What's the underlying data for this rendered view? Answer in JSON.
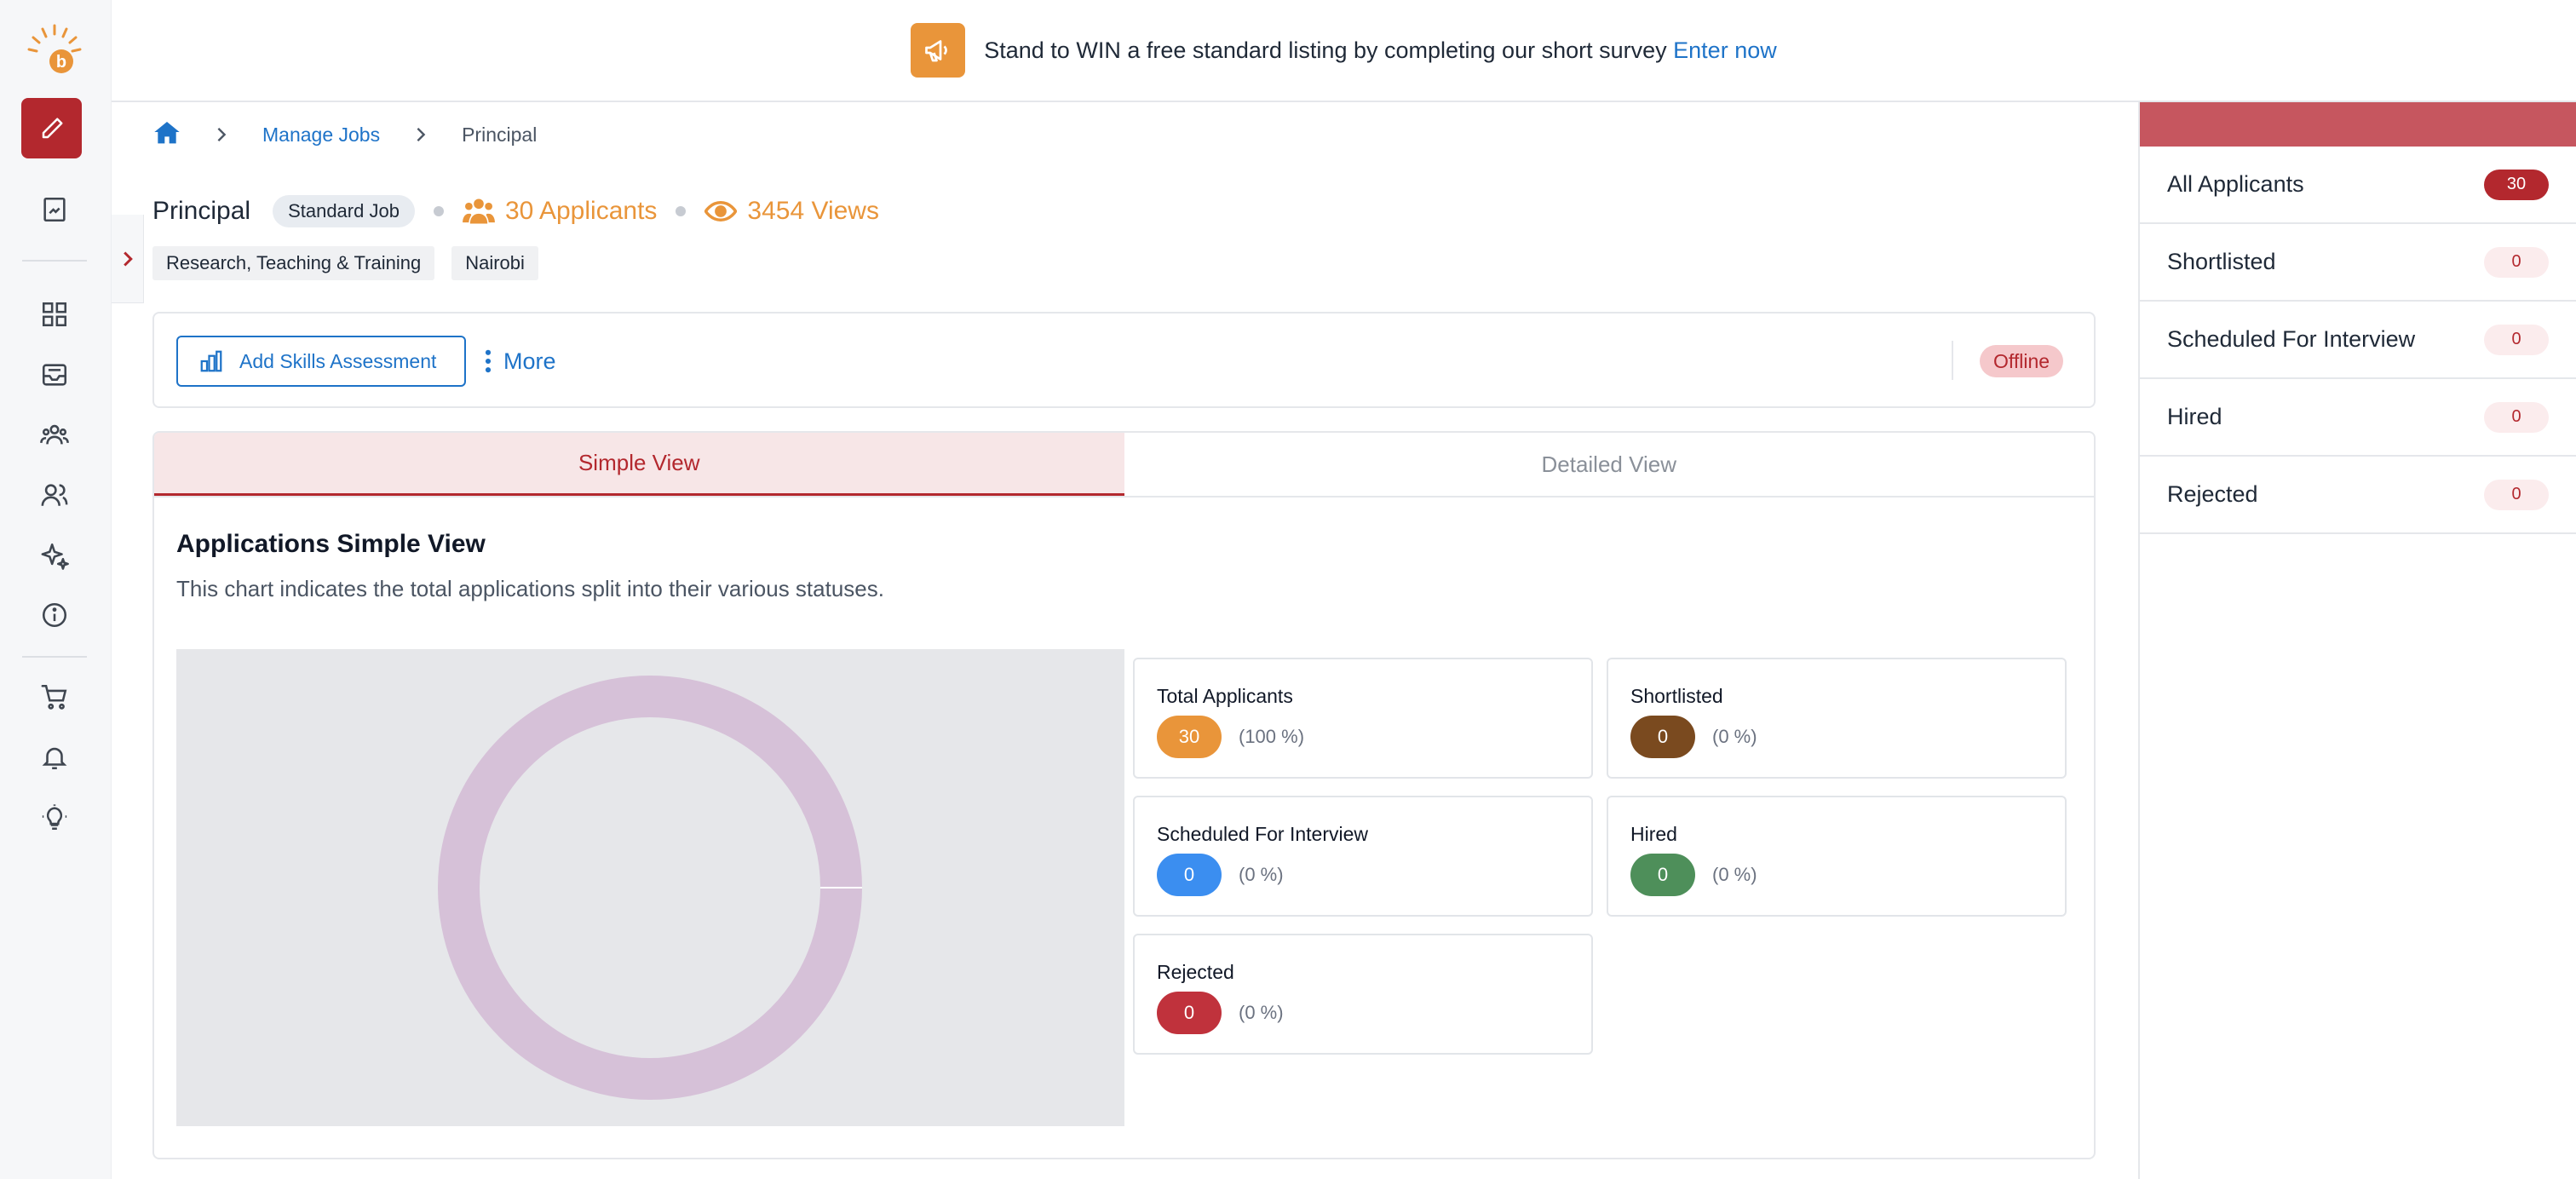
{
  "banner": {
    "message": "Stand to WIN a free standard listing by completing our short survey",
    "cta": "Enter now"
  },
  "breadcrumb": {
    "items": [
      "Manage Jobs",
      "Principal"
    ]
  },
  "job": {
    "title": "Principal",
    "type": "Standard Job",
    "applicants": "30 Applicants",
    "views": "3454 Views",
    "tags": [
      "Research, Teaching & Training",
      "Nairobi"
    ]
  },
  "toolbar": {
    "assess_label": "Add Skills Assessment",
    "more_label": "More",
    "status": "Offline"
  },
  "tabs": [
    {
      "label": "Simple View",
      "active": true
    },
    {
      "label": "Detailed View",
      "active": false
    }
  ],
  "section": {
    "title": "Applications Simple View",
    "description": "This chart indicates the total applications split into their various statuses."
  },
  "stats": [
    {
      "label": "Total Applicants",
      "value": "30",
      "percent": "(100 %)",
      "color": "#e9953a"
    },
    {
      "label": "Shortlisted",
      "value": "0",
      "percent": "(0 %)",
      "color": "#7a4a1f"
    },
    {
      "label": "Scheduled For Interview",
      "value": "0",
      "percent": "(0 %)",
      "color": "#3b8ef0"
    },
    {
      "label": "Hired",
      "value": "0",
      "percent": "(0 %)",
      "color": "#4e8f5a"
    },
    {
      "label": "Rejected",
      "value": "0",
      "percent": "(0 %)",
      "color": "#c0323c"
    }
  ],
  "chart_data": {
    "type": "pie",
    "categories": [
      "Total Applicants",
      "Shortlisted",
      "Scheduled For Interview",
      "Hired",
      "Rejected"
    ],
    "values": [
      30,
      0,
      0,
      0,
      0
    ],
    "ring_color": "#d6c1d8"
  },
  "status_panel": [
    {
      "label": "All Applicants",
      "count": "30",
      "active": true
    },
    {
      "label": "Shortlisted",
      "count": "0",
      "active": false
    },
    {
      "label": "Scheduled For Interview",
      "count": "0",
      "active": false
    },
    {
      "label": "Hired",
      "count": "0",
      "active": false
    },
    {
      "label": "Rejected",
      "count": "0",
      "active": false
    }
  ],
  "colors": {
    "brand": "#b3282e",
    "accent": "#e9953a",
    "link": "#1e73c8"
  }
}
